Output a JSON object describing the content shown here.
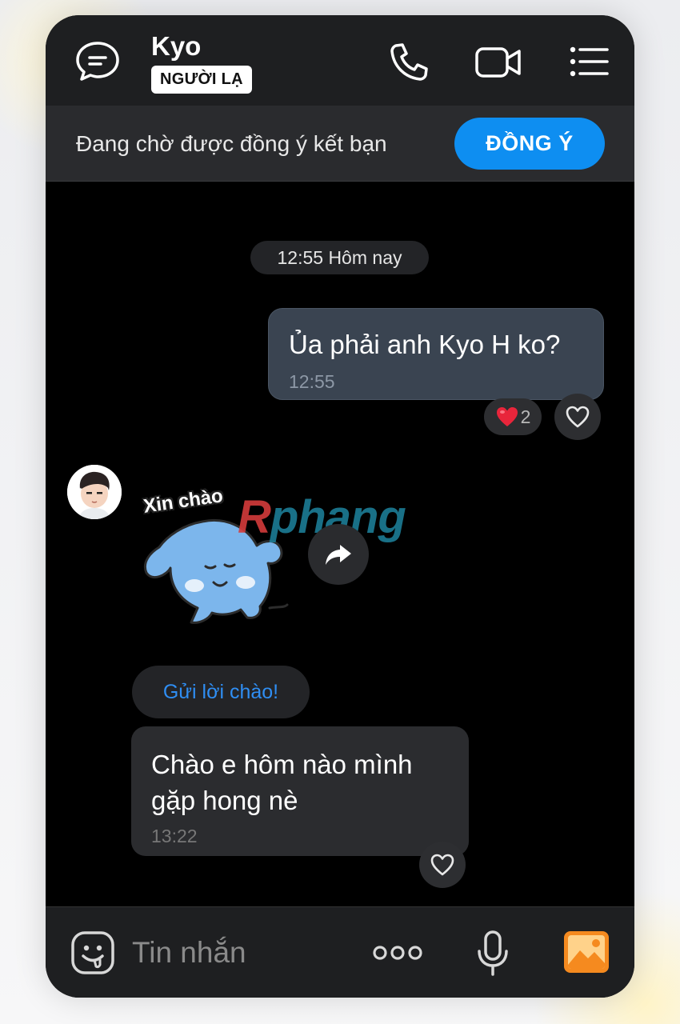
{
  "header": {
    "contact_name": "Kyo",
    "badge": "NGƯỜI LẠ",
    "icons": [
      "chat-bubble-icon",
      "phone-icon",
      "video-camera-icon",
      "menu-list-icon"
    ]
  },
  "friend_request": {
    "status_text": "Đang chờ được đồng ý kết bạn",
    "accept_label": "ĐỒNG Ý"
  },
  "chat": {
    "date_separator": "12:55 Hôm nay",
    "messages": [
      {
        "direction": "outgoing",
        "text": "Ủa phải anh Kyo H ko?",
        "time": "12:55",
        "reaction": {
          "emoji": "❤️",
          "count": "2"
        }
      },
      {
        "direction": "incoming",
        "type": "sticker",
        "sticker_caption": "Xin chào"
      },
      {
        "direction": "incoming",
        "text": "Chào e hôm nào mình gặp hong nè",
        "time": "13:22"
      }
    ],
    "greet_button": "Gửi lời chào!",
    "watermark": {
      "first": "R",
      "rest": "phang"
    }
  },
  "composer": {
    "placeholder": "Tin nhắn",
    "value": ""
  },
  "colors": {
    "accent": "#0e8ef1",
    "outgoing_bubble": "#3a4451",
    "incoming_bubble": "#2b2c2f",
    "link_blue": "#2f8ef3",
    "image_icon": "#f58a1f"
  }
}
